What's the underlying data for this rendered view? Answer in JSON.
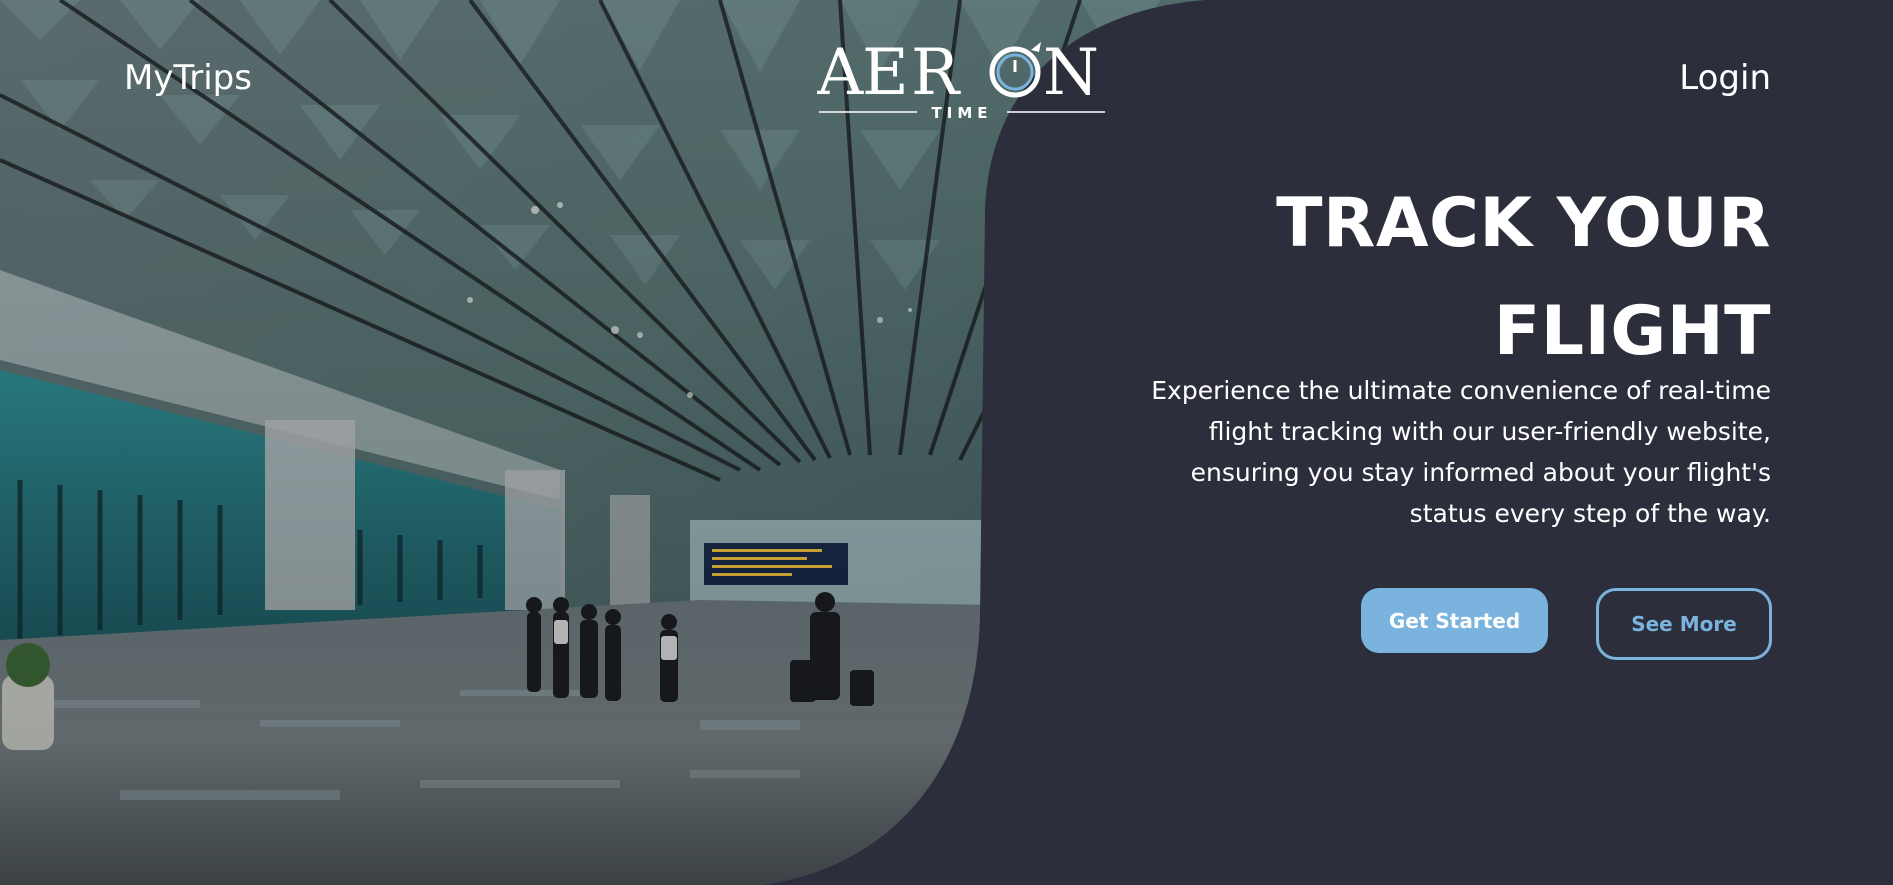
{
  "nav": {
    "left_link": "MyTrips",
    "right_link": "Login"
  },
  "logo": {
    "wordmark": "AERON",
    "subtitle": "TIME",
    "icon": "plane-clock-icon"
  },
  "hero": {
    "title_line1": "TRACK YOUR",
    "title_line2": "FLIGHT",
    "description_lines": [
      "Experience the ultimate convenience of real-time",
      "flight tracking with our user-friendly website,",
      "ensuring you stay informed about your flight's",
      "status every step of the way."
    ],
    "primary_button": "Get Started",
    "secondary_button": "See More"
  },
  "colors": {
    "panel_background": "#2d2e3c",
    "accent": "#7ab3dd",
    "text": "#ffffff"
  }
}
